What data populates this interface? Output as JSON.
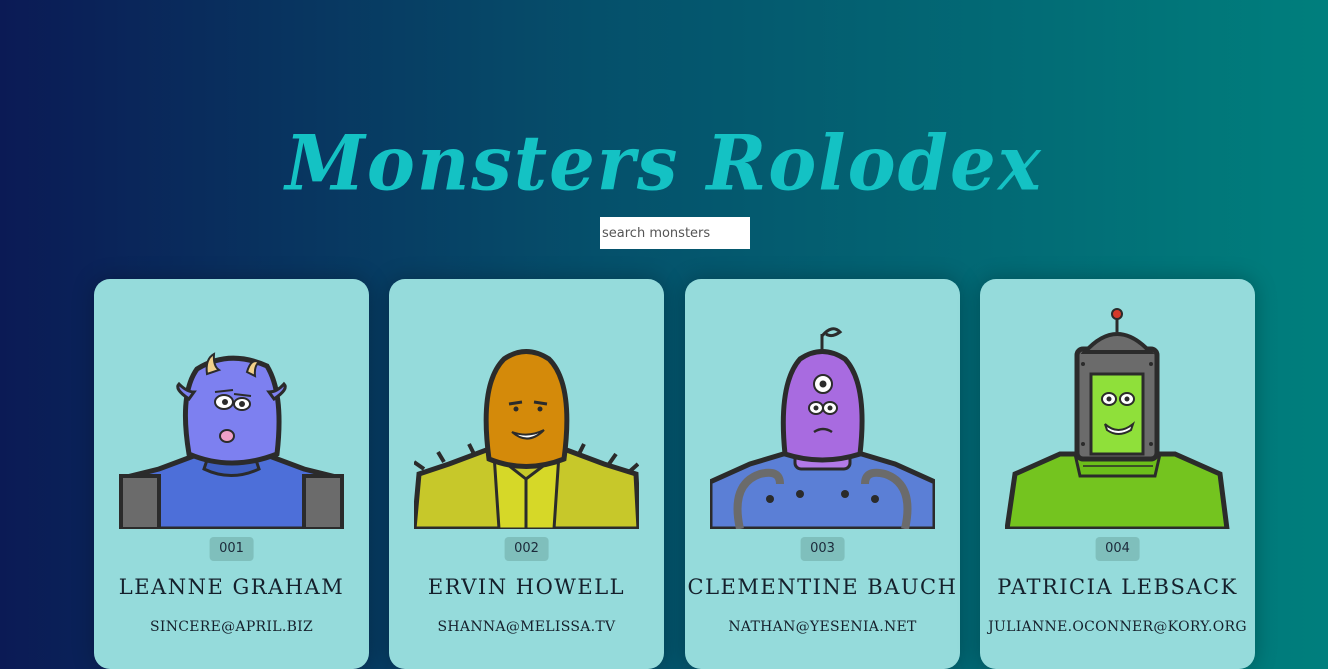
{
  "app": {
    "title": "Monsters Rolodex"
  },
  "search": {
    "placeholder": "search monsters",
    "value": ""
  },
  "monsters": [
    {
      "id": "001",
      "name": "LEANNE GRAHAM",
      "email": "SINCERE@APRIL.BIZ",
      "avatar_icon": "blue-horned-monster-icon"
    },
    {
      "id": "002",
      "name": "ERVIN HOWELL",
      "email": "SHANNA@MELISSA.TV",
      "avatar_icon": "orange-hooded-monster-icon"
    },
    {
      "id": "003",
      "name": "CLEMENTINE BAUCH",
      "email": "NATHAN@YESENIA.NET",
      "avatar_icon": "purple-cyclops-robot-icon"
    },
    {
      "id": "004",
      "name": "PATRICIA LEBSACK",
      "email": "JULIANNE.OCONNER@KORY.ORG",
      "avatar_icon": "green-robot-monster-icon"
    }
  ],
  "colors": {
    "background_start": "#0b1a55",
    "background_end": "#007f7d",
    "title": "#14c2c4",
    "card": "#95dbdb",
    "badge": "#7fbfbc"
  }
}
